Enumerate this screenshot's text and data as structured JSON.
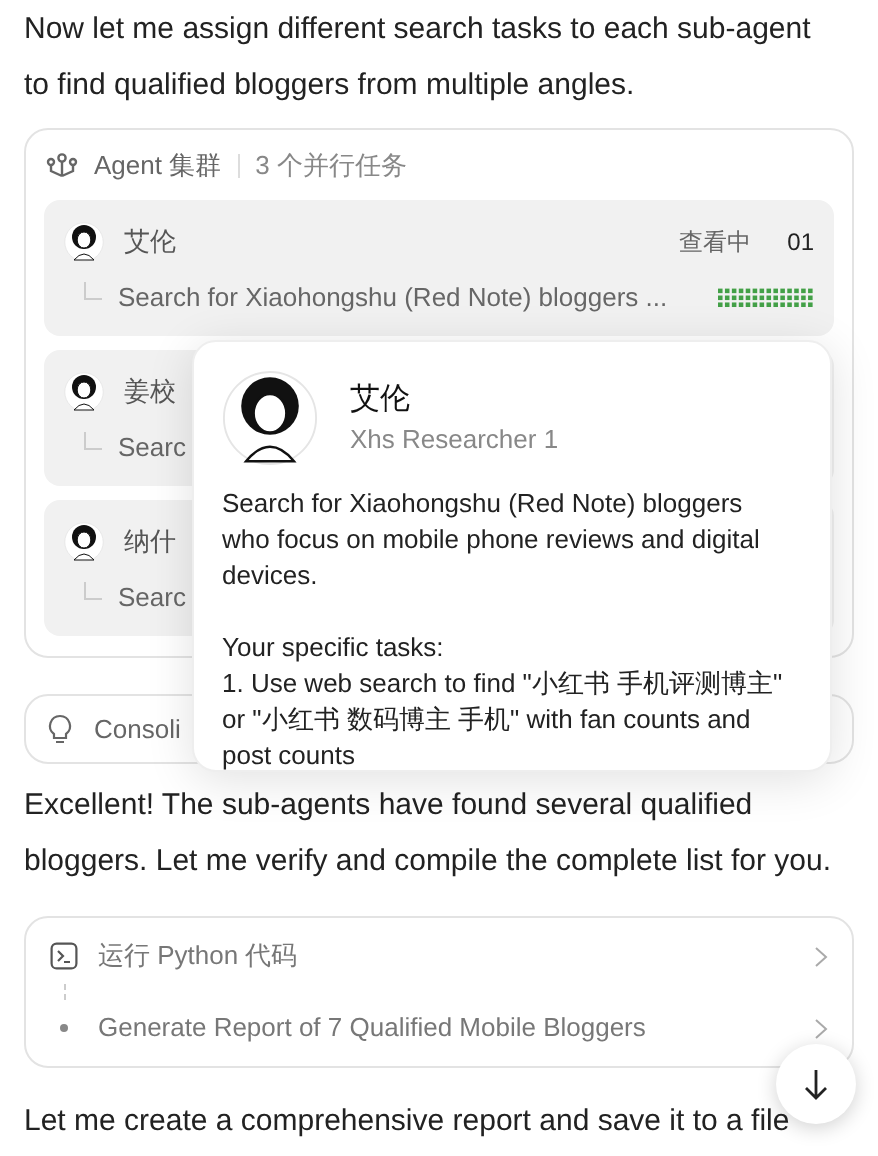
{
  "intro": "Now let me assign different search tasks to each sub-agent to find qualified bloggers from multiple angles.",
  "cluster": {
    "title": "Agent 集群",
    "count": "3 个并行任务",
    "agents": [
      {
        "name": "艾伦",
        "task": "Search for Xiaohongshu (Red Note) bloggers ...",
        "status": "查看中",
        "index": "01"
      },
      {
        "name": "姜校",
        "task": "Searc"
      },
      {
        "name": "纳什",
        "task": "Searc"
      }
    ]
  },
  "consolidate": {
    "label": "Consoli"
  },
  "popup": {
    "name": "艾伦",
    "role": "Xhs Researcher 1",
    "paragraphs": [
      "Search for Xiaohongshu (Red Note) bloggers who focus on mobile phone reviews and digital devices.",
      "Your specific tasks:\n1. Use web search to find \"小红书 手机评测博主\" or \"小红书 数码博主 手机\" with fan counts and post counts"
    ]
  },
  "reply": "Excellent! The sub-agents have found several qualified bloggers. Let me verify and compile the complete list for you.",
  "tool": {
    "title": "运行 Python 代码",
    "step": "Generate Report of 7 Qualified Mobile Bloggers"
  },
  "closing": "Let me create a comprehensive report and save it to a file"
}
